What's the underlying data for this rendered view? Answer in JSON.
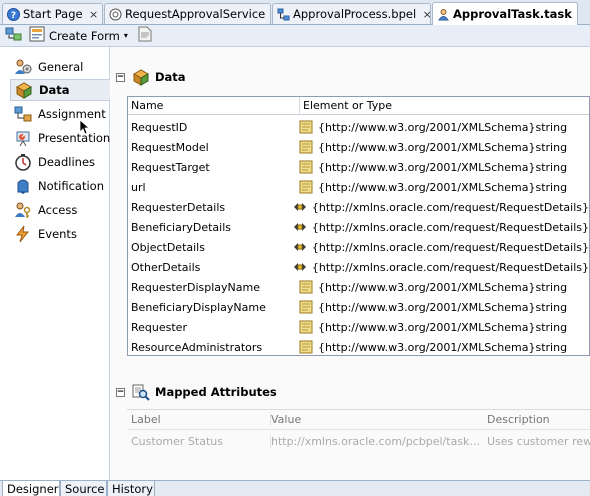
{
  "editor_tabs": [
    {
      "label": "Start Page",
      "icon": "help-icon",
      "active": false
    },
    {
      "label": "RequestApprovalService",
      "icon": "web-service-icon",
      "active": false
    },
    {
      "label": "ApprovalProcess.bpel",
      "icon": "bpel-process-icon",
      "active": false
    },
    {
      "label": "ApprovalTask.task",
      "icon": "human-task-icon",
      "active": true
    }
  ],
  "close_glyph": "×",
  "toolbar": {
    "create_form_label": "Create Form",
    "dropdown_glyph": "▾"
  },
  "nav": {
    "items": [
      {
        "label": "General",
        "icon": "general-icon"
      },
      {
        "label": "Data",
        "icon": "data-icon",
        "active": true
      },
      {
        "label": "Assignment",
        "icon": "assignment-icon"
      },
      {
        "label": "Presentation",
        "icon": "presentation-icon"
      },
      {
        "label": "Deadlines",
        "icon": "deadlines-icon"
      },
      {
        "label": "Notification",
        "icon": "notification-icon"
      },
      {
        "label": "Access",
        "icon": "access-icon"
      },
      {
        "label": "Events",
        "icon": "events-icon"
      }
    ]
  },
  "data_section": {
    "title": "Data",
    "collapse_glyph": "−",
    "columns": [
      "Name",
      "Element or Type"
    ],
    "rows": [
      {
        "name": "RequestID",
        "type": "{http://www.w3.org/2001/XMLSchema}string",
        "kind": "simple"
      },
      {
        "name": "RequestModel",
        "type": "{http://www.w3.org/2001/XMLSchema}string",
        "kind": "simple"
      },
      {
        "name": "RequestTarget",
        "type": "{http://www.w3.org/2001/XMLSchema}string",
        "kind": "simple"
      },
      {
        "name": "url",
        "type": "{http://www.w3.org/2001/XMLSchema}string",
        "kind": "simple"
      },
      {
        "name": "RequesterDetails",
        "type": "{http://xmlns.oracle.com/request/RequestDetails}",
        "kind": "element"
      },
      {
        "name": "BeneficiaryDetails",
        "type": "{http://xmlns.oracle.com/request/RequestDetails}",
        "kind": "element"
      },
      {
        "name": "ObjectDetails",
        "type": "{http://xmlns.oracle.com/request/RequestDetails}",
        "kind": "element"
      },
      {
        "name": "OtherDetails",
        "type": "{http://xmlns.oracle.com/request/RequestDetails}",
        "kind": "element"
      },
      {
        "name": "RequesterDisplayName",
        "type": "{http://www.w3.org/2001/XMLSchema}string",
        "kind": "simple"
      },
      {
        "name": "BeneficiaryDisplayName",
        "type": "{http://www.w3.org/2001/XMLSchema}string",
        "kind": "simple"
      },
      {
        "name": "Requester",
        "type": "{http://www.w3.org/2001/XMLSchema}string",
        "kind": "simple"
      },
      {
        "name": "ResourceAdministrators",
        "type": "{http://www.w3.org/2001/XMLSchema}string",
        "kind": "simple"
      }
    ]
  },
  "mapped_section": {
    "title": "Mapped Attributes",
    "collapse_glyph": "−",
    "columns": [
      "Label",
      "Value",
      "Description"
    ],
    "rows": [
      {
        "label": "Customer Status",
        "value": "http://xmlns.oracle.com/pcbpel/task...",
        "description": "Uses customer rew"
      }
    ]
  },
  "bottom_tabs": [
    {
      "label": "Designer",
      "active": true
    },
    {
      "label": "Source",
      "active": false
    },
    {
      "label": "History",
      "active": false
    }
  ]
}
